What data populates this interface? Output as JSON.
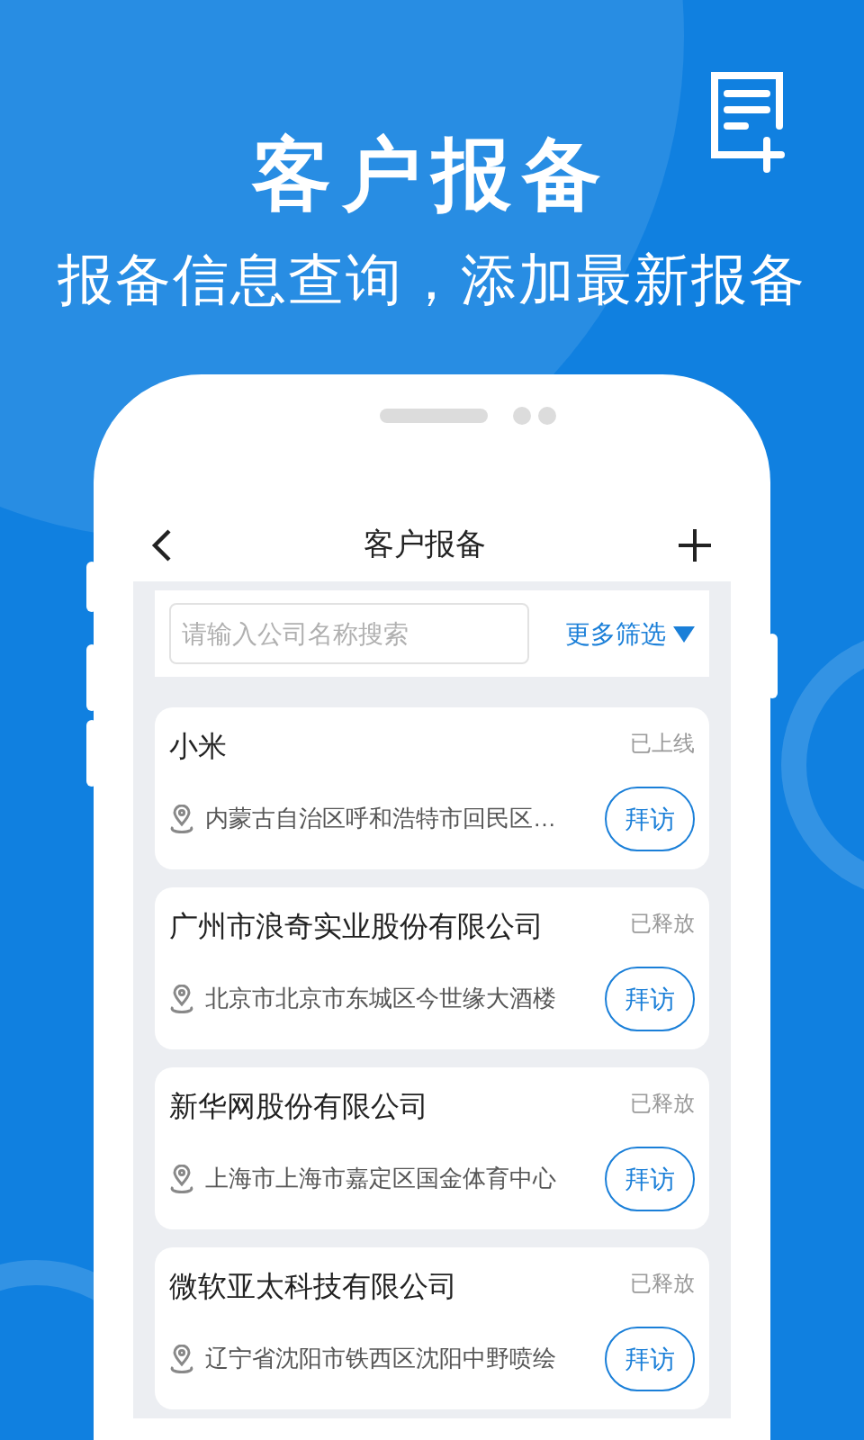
{
  "hero": {
    "title": "客户报备",
    "subtitle": "报备信息查询，添加最新报备"
  },
  "screen": {
    "title": "客户报备",
    "search": {
      "placeholder": "请输入公司名称搜索"
    },
    "filter": "更多筛选",
    "items": [
      {
        "name": "小米",
        "status": "已上线",
        "address": "内蒙古自治区呼和浩特市回民区…",
        "action": "拜访"
      },
      {
        "name": "广州市浪奇实业股份有限公司",
        "status": "已释放",
        "address": "北京市北京市东城区今世缘大酒楼",
        "action": "拜访"
      },
      {
        "name": "新华网股份有限公司",
        "status": "已释放",
        "address": "上海市上海市嘉定区国金体育中心",
        "action": "拜访"
      },
      {
        "name": "微软亚太科技有限公司",
        "status": "已释放",
        "address": "辽宁省沈阳市铁西区沈阳中野喷绘",
        "action": "拜访"
      }
    ]
  }
}
